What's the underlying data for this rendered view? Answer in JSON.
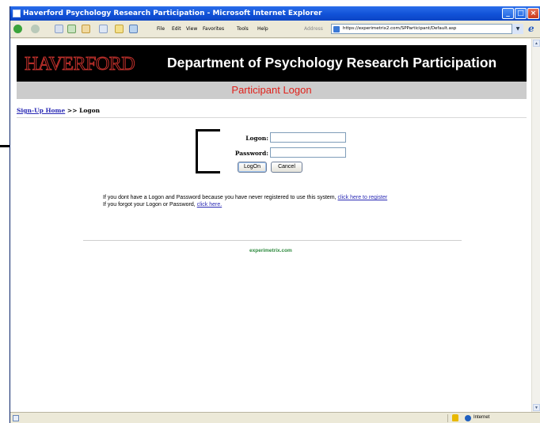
{
  "window": {
    "title": "Haverford Psychology Research Participation - Microsoft Internet Explorer"
  },
  "browser": {
    "menu": [
      "File",
      "Edit",
      "View",
      "Favorites",
      "Tools",
      "Help"
    ],
    "address_label": "Address",
    "url": "https://experimetrix2.com/SPParticipant/Default.asp",
    "status_zone": "Internet"
  },
  "page": {
    "logo_text": "HAVERFORD",
    "banner_title": "Department of Psychology Research Participation",
    "subtitle": "Participant Logon",
    "breadcrumb": {
      "home_link": "Sign-Up Home",
      "separator": ">>",
      "current": "Logon"
    },
    "form": {
      "logon_label": "Logon:",
      "logon_value": "",
      "password_label": "Password:",
      "password_value": "",
      "logon_button": "LogOn",
      "cancel_button": "Cancel"
    },
    "messages": {
      "line1_text": "If you dont have a Logon and Password because you have never registered to use this system,",
      "line1_link": "click here to register",
      "line2_text": "If you forgot your Logon or Password,",
      "line2_link": "click here."
    },
    "footer_link": "experimetrix.com"
  },
  "colors": {
    "title_bar": "#1152d8",
    "banner_bg": "#000000",
    "subtitle_bar": "#cccccc",
    "subtitle_text": "#e0221c",
    "link": "#2b2bb5",
    "footer_link": "#2e8a3e"
  }
}
